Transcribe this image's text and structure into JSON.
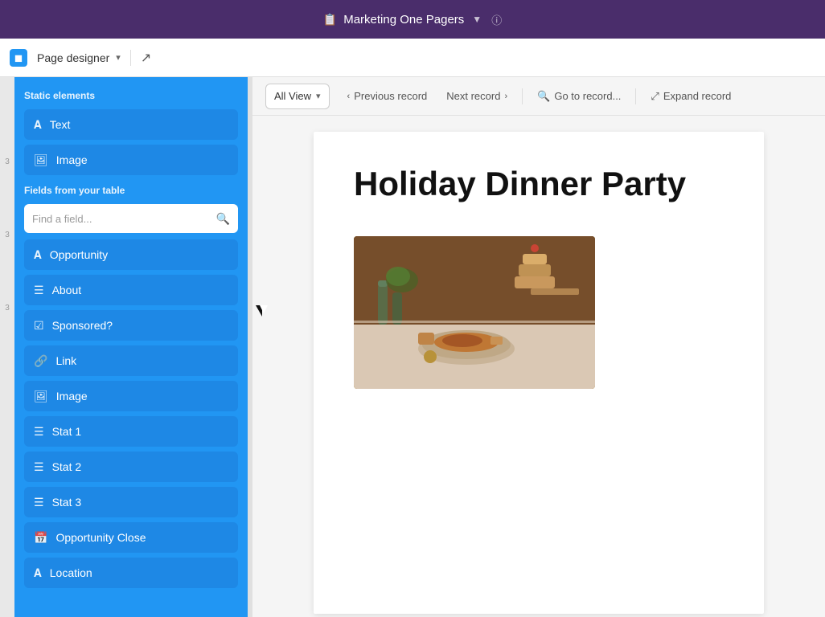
{
  "header": {
    "title": "Marketing One Pagers",
    "icon": "📋",
    "info_icon": "ⓘ"
  },
  "toolbar": {
    "app_logo": "◼",
    "designer_label": "Page designer",
    "external_icon": "↗"
  },
  "sidebar": {
    "static_section_label": "Static elements",
    "fields_section_label": "Fields from your table",
    "search_placeholder": "Find a field...",
    "static_items": [
      {
        "id": "text",
        "label": "Text",
        "icon": "A"
      },
      {
        "id": "image",
        "label": "Image",
        "icon": "🖼"
      }
    ],
    "field_items": [
      {
        "id": "opportunity",
        "label": "Opportunity",
        "icon": "A"
      },
      {
        "id": "about",
        "label": "About",
        "icon": "≡"
      },
      {
        "id": "sponsored",
        "label": "Sponsored?",
        "icon": "☑"
      },
      {
        "id": "link",
        "label": "Link",
        "icon": "🔗"
      },
      {
        "id": "image2",
        "label": "Image",
        "icon": "🖼"
      },
      {
        "id": "stat1",
        "label": "Stat 1",
        "icon": "≡"
      },
      {
        "id": "stat2",
        "label": "Stat 2",
        "icon": "≡"
      },
      {
        "id": "stat3",
        "label": "Stat 3",
        "icon": "≡"
      },
      {
        "id": "opp-close",
        "label": "Opportunity Close",
        "icon": "📅"
      },
      {
        "id": "location",
        "label": "Location",
        "icon": "A"
      }
    ]
  },
  "nav": {
    "view_label": "All View",
    "prev_label": "Previous record",
    "next_label": "Next record",
    "goto_label": "Go to record...",
    "expand_label": "Expand record"
  },
  "page": {
    "title": "Holiday Dinner Party"
  },
  "left_numbers": [
    "3",
    "3",
    "3"
  ]
}
